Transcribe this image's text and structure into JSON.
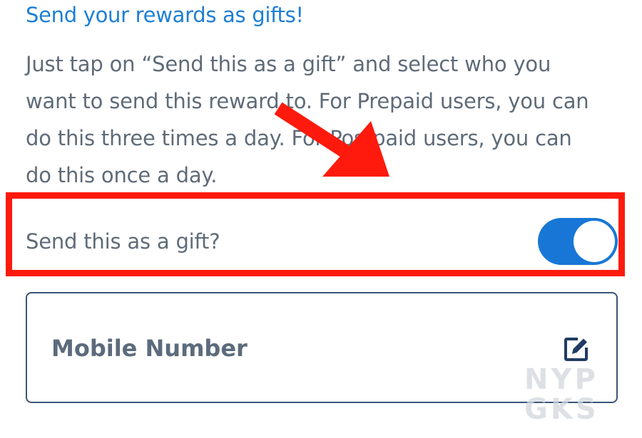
{
  "header": {
    "title": "Send your rewards as gifts!"
  },
  "description": {
    "lines": [
      "Just tap on “Send this as a gift” and select who you",
      "want to send this reward to. For Prepaid users, you can",
      "do this three times a day. For Postpaid users, you can",
      "do this once a day."
    ]
  },
  "gift_toggle": {
    "label": "Send this as a gift?",
    "state": "on",
    "color": "#1877d6"
  },
  "mobile_field": {
    "label": "Mobile Number",
    "icon": "edit-icon"
  },
  "annotation": {
    "arrow_color": "#ff1a0d",
    "highlight_color": "#ff1a0d"
  },
  "watermark": {
    "line1": "NYP",
    "line2": "GKS"
  }
}
